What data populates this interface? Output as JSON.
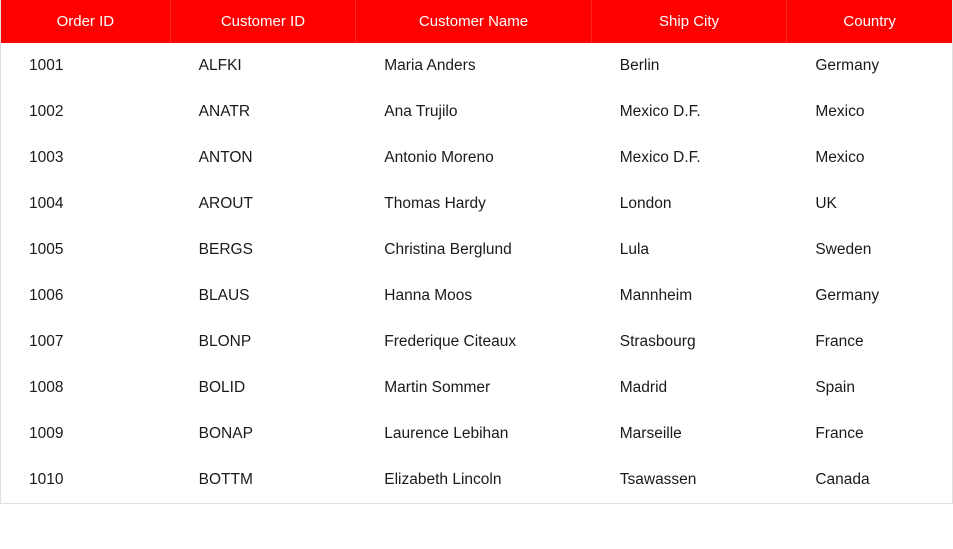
{
  "grid": {
    "columns": [
      {
        "label": "Order ID",
        "key": "orderId"
      },
      {
        "label": "Customer ID",
        "key": "customerId"
      },
      {
        "label": "Customer Name",
        "key": "customerName"
      },
      {
        "label": "Ship City",
        "key": "shipCity"
      },
      {
        "label": "Country",
        "key": "country"
      }
    ],
    "rows": [
      {
        "orderId": "1001",
        "customerId": "ALFKI",
        "customerName": "Maria Anders",
        "shipCity": "Berlin",
        "country": "Germany"
      },
      {
        "orderId": "1002",
        "customerId": "ANATR",
        "customerName": "Ana Trujilo",
        "shipCity": "Mexico D.F.",
        "country": "Mexico"
      },
      {
        "orderId": "1003",
        "customerId": "ANTON",
        "customerName": "Antonio Moreno",
        "shipCity": "Mexico D.F.",
        "country": "Mexico"
      },
      {
        "orderId": "1004",
        "customerId": "AROUT",
        "customerName": "Thomas Hardy",
        "shipCity": "London",
        "country": "UK"
      },
      {
        "orderId": "1005",
        "customerId": "BERGS",
        "customerName": "Christina Berglund",
        "shipCity": "Lula",
        "country": "Sweden"
      },
      {
        "orderId": "1006",
        "customerId": "BLAUS",
        "customerName": "Hanna Moos",
        "shipCity": "Mannheim",
        "country": "Germany"
      },
      {
        "orderId": "1007",
        "customerId": "BLONP",
        "customerName": "Frederique Citeaux",
        "shipCity": "Strasbourg",
        "country": "France"
      },
      {
        "orderId": "1008",
        "customerId": "BOLID",
        "customerName": "Martin Sommer",
        "shipCity": "Madrid",
        "country": "Spain"
      },
      {
        "orderId": "1009",
        "customerId": "BONAP",
        "customerName": "Laurence Lebihan",
        "shipCity": "Marseille",
        "country": "France"
      },
      {
        "orderId": "1010",
        "customerId": "BOTTM",
        "customerName": "Elizabeth Lincoln",
        "shipCity": "Tsawassen",
        "country": "Canada"
      }
    ]
  }
}
